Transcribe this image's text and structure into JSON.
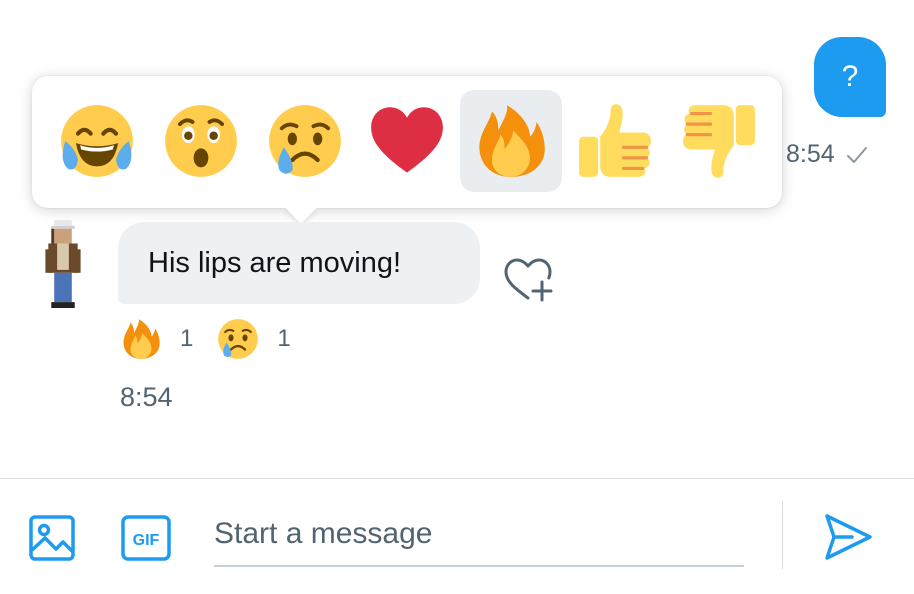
{
  "colors": {
    "accent": "#1d9bf0",
    "bubble_incoming": "#eef1f4",
    "muted_text": "#536471",
    "selected_highlight": "#e9edf0"
  },
  "outgoing_message": {
    "text": "?",
    "time": "8:54",
    "status_icon": "checkmark-icon"
  },
  "reaction_picker": {
    "options": [
      {
        "name": "tears-of-joy"
      },
      {
        "name": "surprised"
      },
      {
        "name": "crying"
      },
      {
        "name": "heart"
      },
      {
        "name": "fire",
        "selected": true
      },
      {
        "name": "thumbs-up"
      },
      {
        "name": "thumbs-down"
      }
    ]
  },
  "incoming_message": {
    "text": "His lips are moving!",
    "time": "8:54",
    "add_reaction_icon": "heart-plus-icon",
    "reactions": [
      {
        "emoji": "fire",
        "count": "1"
      },
      {
        "emoji": "crying",
        "count": "1"
      }
    ]
  },
  "composer": {
    "placeholder": "Start a message",
    "media_icon": "image-icon",
    "gif_label": "GIF",
    "send_icon": "send-icon"
  }
}
